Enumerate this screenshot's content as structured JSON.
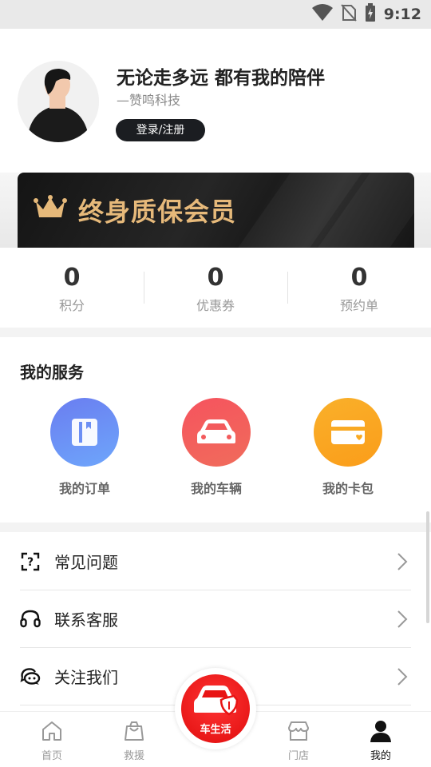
{
  "status_bar": {
    "time": "9:12"
  },
  "profile": {
    "slogan": "无论走多远 都有我的陪伴",
    "subtitle": "—赞鸣科技",
    "login_label": "登录/注册"
  },
  "vip": {
    "title": "终身质保会员",
    "accent_color": "#e6b97a"
  },
  "stats": [
    {
      "value": "0",
      "label": "积分"
    },
    {
      "value": "0",
      "label": "优惠券"
    },
    {
      "value": "0",
      "label": "预约单"
    }
  ],
  "services": {
    "title": "我的服务",
    "items": [
      {
        "label": "我的订单",
        "icon": "order-icon",
        "color": "#6a8cf5"
      },
      {
        "label": "我的车辆",
        "icon": "car-icon",
        "color": "#f2454a"
      },
      {
        "label": "我的卡包",
        "icon": "card-wallet-icon",
        "color": "#f9a21a"
      }
    ]
  },
  "menu": [
    {
      "label": "常见问题",
      "icon": "faq-icon"
    },
    {
      "label": "联系客服",
      "icon": "headset-icon"
    },
    {
      "label": "关注我们",
      "icon": "chat-icon"
    }
  ],
  "tabbar": {
    "tabs": [
      {
        "label": "首页",
        "icon": "home-icon"
      },
      {
        "label": "救援",
        "icon": "bag-icon"
      },
      {
        "label": "门店",
        "icon": "store-icon"
      },
      {
        "label": "我的",
        "icon": "profile-icon",
        "active": true
      }
    ],
    "center": {
      "label": "车生活",
      "icon": "car-shield-icon",
      "color": "#e81414"
    }
  }
}
